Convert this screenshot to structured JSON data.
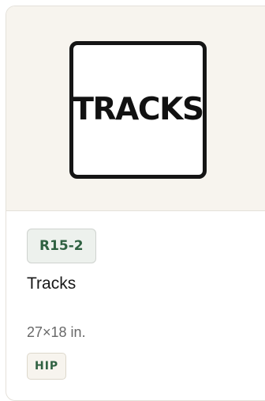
{
  "card": {
    "image_text": "TRACKS",
    "code": "R15-2",
    "title": "Tracks",
    "size": "27×18 in.",
    "tag": "HIP"
  },
  "colors": {
    "thumbnail_background": "#f7f4ee",
    "accent_green": "#2f6141",
    "code_badge_background": "#edf1ed",
    "tag_background": "#f7f4ee"
  }
}
